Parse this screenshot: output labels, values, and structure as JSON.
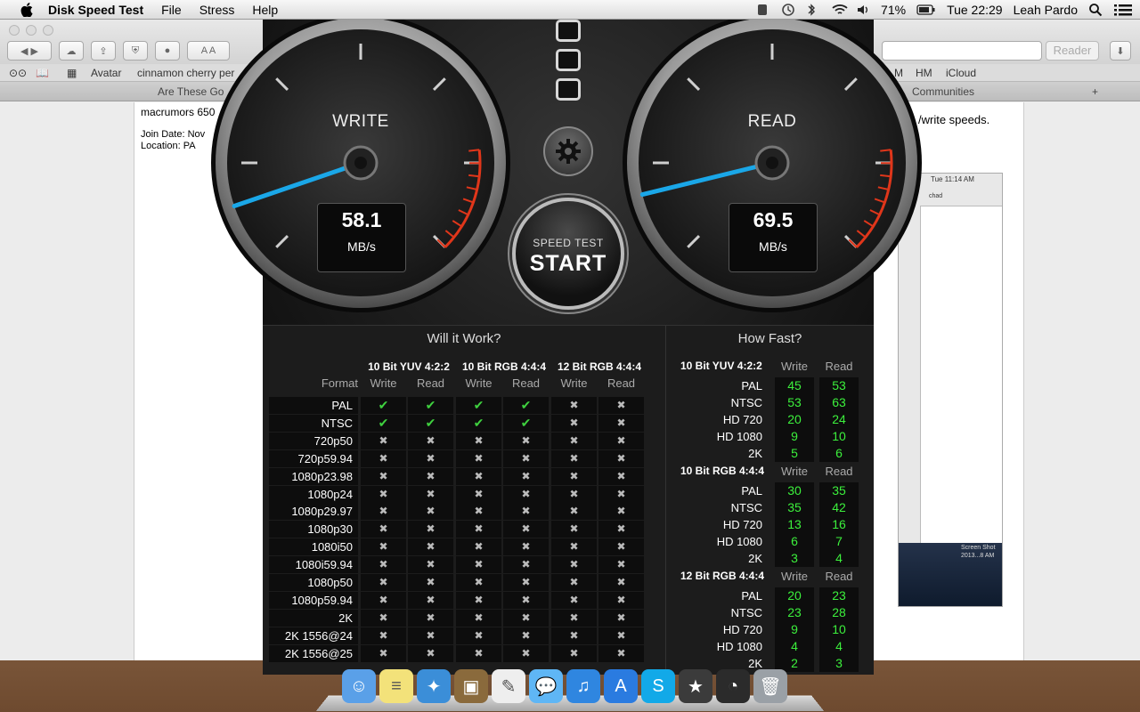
{
  "menubar": {
    "app_name": "Disk Speed Test",
    "menus": [
      "File",
      "Stress",
      "Help"
    ],
    "battery": "71%",
    "clock": "Tue 22:29",
    "user": "Leah Pardo"
  },
  "browser": {
    "reader_label": "Reader",
    "bookmarks": [
      "Avatar",
      "cinnamon cherry per",
      "M",
      "HM",
      "iCloud"
    ],
    "tabs": [
      "Are These Go",
      "Communities"
    ],
    "content": {
      "user_title": "macrumors 650",
      "join_date": "Join Date: Nov",
      "location": "Location: PA",
      "text_fragment": "/write speeds."
    },
    "thumb": {
      "clock": "Tue 11:14 AM",
      "tab": "chad",
      "caption1": "Screen Shot",
      "caption2": "2013...8 AM"
    }
  },
  "app": {
    "write_gauge": {
      "title": "WRITE",
      "value": "58.1",
      "unit": "MB/s",
      "needle_value": 58.1
    },
    "read_gauge": {
      "title": "READ",
      "value": "69.5",
      "unit": "MB/s",
      "needle_value": 69.5
    },
    "start_button": {
      "line1": "SPEED TEST",
      "line2": "START"
    },
    "will_it_work": {
      "title": "Will it Work?",
      "groups": [
        "10 Bit YUV 4:2:2",
        "10 Bit RGB 4:4:4",
        "12 Bit RGB 4:4:4"
      ],
      "format_label": "Format",
      "write_label": "Write",
      "read_label": "Read",
      "rows": [
        {
          "format": "PAL",
          "results": [
            true,
            true,
            true,
            true,
            false,
            false
          ]
        },
        {
          "format": "NTSC",
          "results": [
            true,
            true,
            true,
            true,
            false,
            false
          ]
        },
        {
          "format": "720p50",
          "results": [
            false,
            false,
            false,
            false,
            false,
            false
          ]
        },
        {
          "format": "720p59.94",
          "results": [
            false,
            false,
            false,
            false,
            false,
            false
          ]
        },
        {
          "format": "1080p23.98",
          "results": [
            false,
            false,
            false,
            false,
            false,
            false
          ]
        },
        {
          "format": "1080p24",
          "results": [
            false,
            false,
            false,
            false,
            false,
            false
          ]
        },
        {
          "format": "1080p29.97",
          "results": [
            false,
            false,
            false,
            false,
            false,
            false
          ]
        },
        {
          "format": "1080p30",
          "results": [
            false,
            false,
            false,
            false,
            false,
            false
          ]
        },
        {
          "format": "1080i50",
          "results": [
            false,
            false,
            false,
            false,
            false,
            false
          ]
        },
        {
          "format": "1080i59.94",
          "results": [
            false,
            false,
            false,
            false,
            false,
            false
          ]
        },
        {
          "format": "1080p50",
          "results": [
            false,
            false,
            false,
            false,
            false,
            false
          ]
        },
        {
          "format": "1080p59.94",
          "results": [
            false,
            false,
            false,
            false,
            false,
            false
          ]
        },
        {
          "format": "2K 1556@23.98",
          "results": [
            false,
            false,
            false,
            false,
            false,
            false
          ]
        },
        {
          "format": "2K 1556@24",
          "results": [
            false,
            false,
            false,
            false,
            false,
            false
          ]
        },
        {
          "format": "2K 1556@25",
          "results": [
            false,
            false,
            false,
            false,
            false,
            false
          ]
        }
      ]
    },
    "how_fast": {
      "title": "How Fast?",
      "write_label": "Write",
      "read_label": "Read",
      "sections": [
        {
          "name": "10 Bit YUV 4:2:2",
          "rows": [
            {
              "label": "PAL",
              "write": "45",
              "read": "53"
            },
            {
              "label": "NTSC",
              "write": "53",
              "read": "63"
            },
            {
              "label": "HD 720",
              "write": "20",
              "read": "24"
            },
            {
              "label": "HD 1080",
              "write": "9",
              "read": "10"
            },
            {
              "label": "2K",
              "write": "5",
              "read": "6"
            }
          ]
        },
        {
          "name": "10 Bit RGB 4:4:4",
          "rows": [
            {
              "label": "PAL",
              "write": "30",
              "read": "35"
            },
            {
              "label": "NTSC",
              "write": "35",
              "read": "42"
            },
            {
              "label": "HD 720",
              "write": "13",
              "read": "16"
            },
            {
              "label": "HD 1080",
              "write": "6",
              "read": "7"
            },
            {
              "label": "2K",
              "write": "3",
              "read": "4"
            }
          ]
        },
        {
          "name": "12 Bit RGB 4:4:4",
          "rows": [
            {
              "label": "PAL",
              "write": "20",
              "read": "23"
            },
            {
              "label": "NTSC",
              "write": "23",
              "read": "28"
            },
            {
              "label": "HD 720",
              "write": "9",
              "read": "10"
            },
            {
              "label": "HD 1080",
              "write": "4",
              "read": "4"
            },
            {
              "label": "2K",
              "write": "2",
              "read": "3"
            }
          ]
        }
      ]
    }
  },
  "dock": {
    "apps": [
      "finder-icon",
      "stickies-icon",
      "safari-icon",
      "iphoto-icon",
      "textedit-icon",
      "messages-icon",
      "itunes-icon",
      "app-store-icon",
      "skype-icon",
      "imovie-icon",
      "disk-speed-test-icon",
      "trash-icon"
    ]
  },
  "colors": {
    "needle": "#1aa7e8",
    "ok": "#3fd13f",
    "speed_value": "#3cf03c",
    "redline": "#e0361a"
  }
}
